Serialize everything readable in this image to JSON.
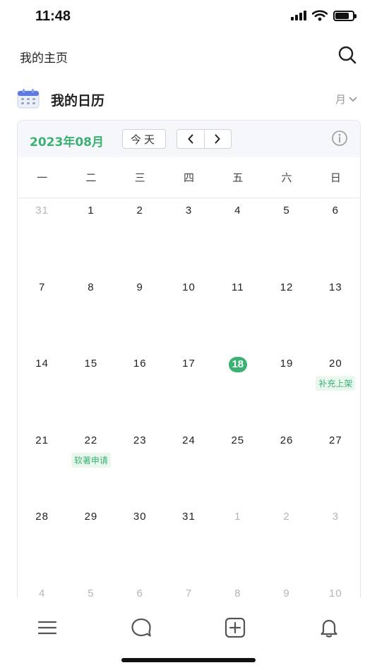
{
  "status_bar": {
    "time": "11:48"
  },
  "header": {
    "title": "我的主页",
    "search_icon": "search-icon"
  },
  "section": {
    "title": "我的日历",
    "view_label": "月",
    "icon": "calendar-icon"
  },
  "calendar": {
    "month_label": "2023年08月",
    "today_label": "今天",
    "weekdays": [
      "一",
      "二",
      "三",
      "四",
      "五",
      "六",
      "日"
    ],
    "weeks": [
      [
        {
          "d": "31",
          "o": true
        },
        {
          "d": "1"
        },
        {
          "d": "2"
        },
        {
          "d": "3"
        },
        {
          "d": "4"
        },
        {
          "d": "5"
        },
        {
          "d": "6"
        }
      ],
      [
        {
          "d": "7"
        },
        {
          "d": "8"
        },
        {
          "d": "9"
        },
        {
          "d": "10"
        },
        {
          "d": "11"
        },
        {
          "d": "12"
        },
        {
          "d": "13"
        }
      ],
      [
        {
          "d": "14"
        },
        {
          "d": "15"
        },
        {
          "d": "16"
        },
        {
          "d": "17"
        },
        {
          "d": "18",
          "today": true
        },
        {
          "d": "19"
        },
        {
          "d": "20",
          "event": "补充上架"
        }
      ],
      [
        {
          "d": "21"
        },
        {
          "d": "22",
          "event": "软著申请"
        },
        {
          "d": "23"
        },
        {
          "d": "24"
        },
        {
          "d": "25"
        },
        {
          "d": "26"
        },
        {
          "d": "27"
        }
      ],
      [
        {
          "d": "28"
        },
        {
          "d": "29"
        },
        {
          "d": "30"
        },
        {
          "d": "31"
        },
        {
          "d": "1",
          "o": true
        },
        {
          "d": "2",
          "o": true
        },
        {
          "d": "3",
          "o": true
        }
      ],
      [
        {
          "d": "4",
          "o": true
        },
        {
          "d": "5",
          "o": true
        },
        {
          "d": "6",
          "o": true
        },
        {
          "d": "7",
          "o": true
        },
        {
          "d": "8",
          "o": true
        },
        {
          "d": "9",
          "o": true
        },
        {
          "d": "10",
          "o": true
        }
      ]
    ]
  },
  "tabs": [
    {
      "icon": "menu-icon"
    },
    {
      "icon": "chat-icon"
    },
    {
      "icon": "add-icon"
    },
    {
      "icon": "bell-icon"
    }
  ],
  "colors": {
    "accent": "#3bb273",
    "event_bg": "#eaf7ef",
    "muted": "#b5b5b5"
  }
}
